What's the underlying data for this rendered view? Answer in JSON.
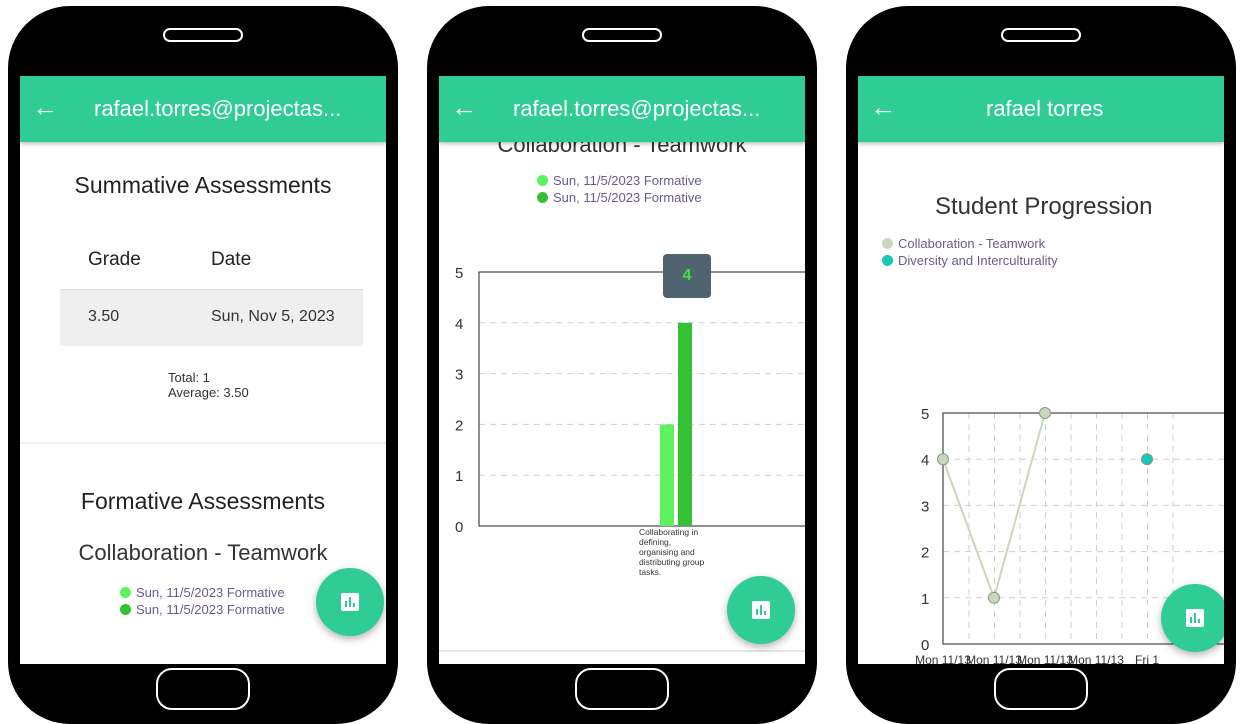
{
  "colors": {
    "accent": "#2fcc96",
    "series_light": "#5ff25f",
    "series_dark": "#33c233",
    "progression_1": "#c9d8bd",
    "progression_2": "#19c7b8",
    "tooltip_bg": "#4f6470"
  },
  "phone1": {
    "header": {
      "back_icon": "arrow-left-icon",
      "title": "rafael.torres@projectas..."
    },
    "summative": {
      "title": "Summative Assessments",
      "columns": [
        "Grade",
        "Date"
      ],
      "rows": [
        {
          "grade": "3.50",
          "date": "Sun, Nov 5, 2023"
        }
      ],
      "total": "Total: 1",
      "average": "Average: 3.50"
    },
    "formative": {
      "title": "Formative Assessments",
      "chart_title": "Collaboration - Teamwork",
      "legend": [
        "Sun, 11/5/2023 Formative",
        "Sun, 11/5/2023 Formative"
      ]
    }
  },
  "phone2": {
    "header": {
      "back_icon": "arrow-left-icon",
      "title": "rafael.torres@projectas..."
    },
    "tooltip": "4"
  },
  "phone3": {
    "header": {
      "back_icon": "arrow-left-icon",
      "title": "rafael torres"
    },
    "chart_title": "Student Progression",
    "legend": [
      "Collaboration - Teamwork",
      "Diversity and Interculturality"
    ]
  },
  "chart_data": [
    {
      "type": "bar",
      "title": "Collaboration - Teamwork",
      "categories": [
        "Collaborating in defining, organising and distributing group tasks."
      ],
      "category_lines": [
        "Collaborating in",
        "defining,",
        "organising and",
        "distributing group",
        "tasks."
      ],
      "series": [
        {
          "name": "Sun, 11/5/2023 Formative",
          "values": [
            2
          ],
          "color": "#5ff25f"
        },
        {
          "name": "Sun, 11/5/2023 Formative",
          "values": [
            4
          ],
          "color": "#33c233"
        }
      ],
      "ylim": [
        0,
        5
      ],
      "yticks": [
        "0",
        "1",
        "2",
        "3",
        "4",
        "5"
      ],
      "grid": true
    },
    {
      "type": "line",
      "title": "Student Progression",
      "x": [
        "Mon 11/13",
        "Mon 11/13",
        "Mon 11/13",
        "Mon 11/13",
        "Fri 1"
      ],
      "series": [
        {
          "name": "Collaboration - Teamwork",
          "values": [
            4,
            1,
            5
          ],
          "color": "#c9d8bd"
        },
        {
          "name": "Diversity and Interculturality",
          "values": [
            null,
            null,
            null,
            null,
            4
          ],
          "color": "#19c7b8"
        }
      ],
      "ylim": [
        0,
        5
      ],
      "yticks": [
        "0",
        "1",
        "2",
        "3",
        "4",
        "5"
      ],
      "grid": true
    }
  ]
}
